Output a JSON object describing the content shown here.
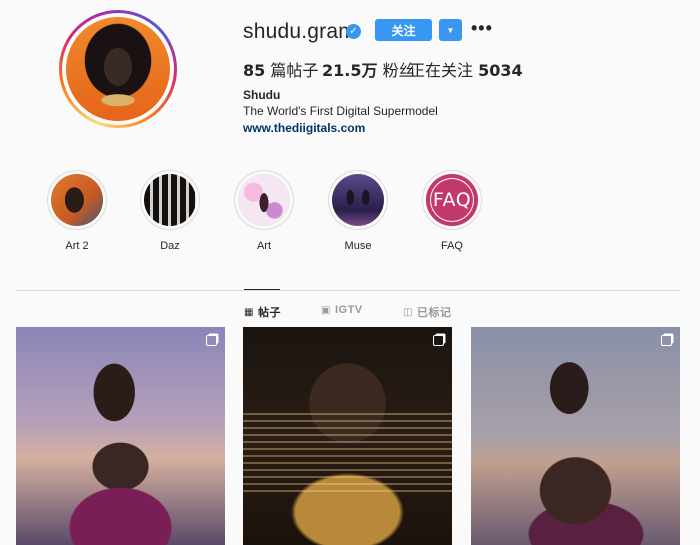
{
  "profile": {
    "username": "shudu.gram",
    "verified_glyph": "✓",
    "follow_label": "关注",
    "dropdown_glyph": "▼",
    "more_glyph": "•••",
    "stats": {
      "posts_count": "85",
      "posts_label": "篇帖子",
      "followers_count": "21.5万",
      "followers_label": "粉丝",
      "following_label": "正在关注",
      "following_count": "5034"
    },
    "full_name": "Shudu",
    "bio": "The World's First Digital Supermodel",
    "website": "www.thediigitals.com"
  },
  "highlights": [
    {
      "label": "Art 2",
      "icon": "highlight-cover-art2"
    },
    {
      "label": "Daz",
      "icon": "highlight-cover-daz"
    },
    {
      "label": "Art",
      "icon": "highlight-cover-art"
    },
    {
      "label": "Muse",
      "icon": "highlight-cover-muse"
    },
    {
      "label": "FAQ",
      "icon": "highlight-cover-faq",
      "cover_text": "FAQ"
    }
  ],
  "tabs": [
    {
      "label": "帖子",
      "icon": "grid-icon",
      "glyph": "▦",
      "active": true
    },
    {
      "label": "IGTV",
      "icon": "igtv-icon",
      "glyph": "▣",
      "active": false
    },
    {
      "label": "已标记",
      "icon": "tagged-icon",
      "glyph": "◫",
      "active": false
    }
  ],
  "posts": [
    {
      "icon": "multiple-photos-icon"
    },
    {
      "icon": "multiple-photos-icon"
    },
    {
      "icon": "multiple-photos-icon"
    }
  ],
  "colors": {
    "accent": "#3897f0",
    "background": "#fafafa",
    "text": "#262626",
    "link": "#003569",
    "faq_cover": "#c2386a"
  }
}
